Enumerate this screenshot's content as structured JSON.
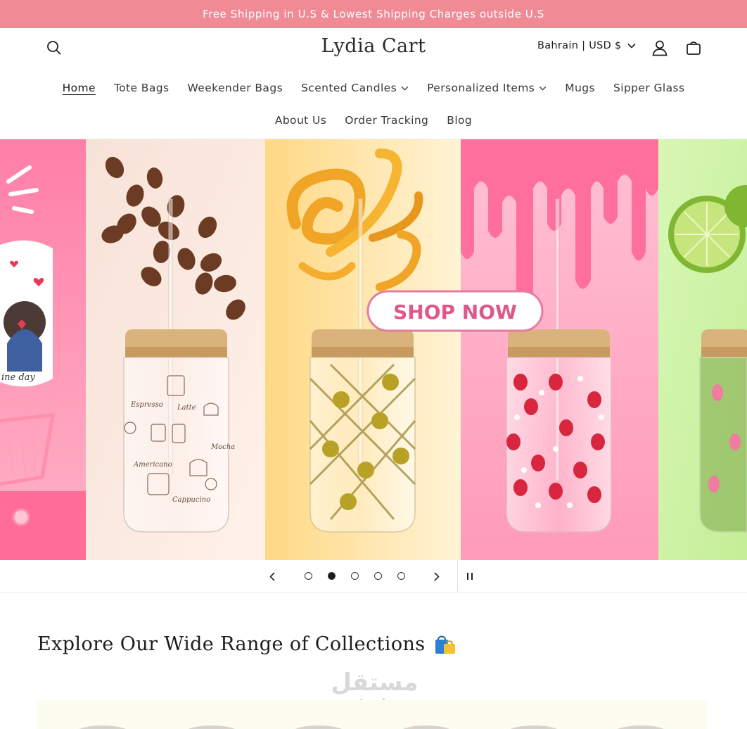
{
  "announcement": "Free Shipping in U.S & Lowest Shipping Charges outside U.S",
  "header": {
    "logo": "Lydia Cart",
    "locale": "Bahrain | USD $"
  },
  "nav": {
    "row1": [
      "Home",
      "Tote Bags",
      "Weekender Bags",
      "Scented Candles",
      "Personalized Items",
      "Mugs",
      "Sipper Glass"
    ],
    "row2": [
      "About Us",
      "Order Tracking",
      "Blog"
    ]
  },
  "hero": {
    "cta": "SHOP NOW",
    "mug_text": "ine day",
    "coffee_labels": [
      "Espresso",
      "Latte",
      "Mocha",
      "Americano",
      "Cappucino"
    ]
  },
  "slideshow": {
    "slide_count": 5,
    "active_slide": 2
  },
  "collections": {
    "title": "Explore Our Wide Range of Collections",
    "emoji": "🛍️"
  },
  "watermark": {
    "arabic": "مستقل",
    "latin": "mostaql.com"
  },
  "colors": {
    "announcement_bg": "#f08a95",
    "cta_text": "#e0578a"
  }
}
